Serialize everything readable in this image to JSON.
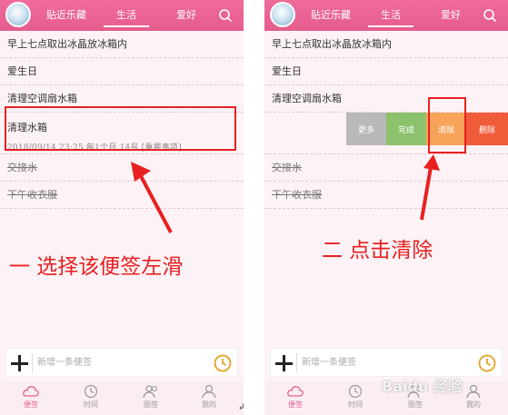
{
  "left_phone": {
    "tabs": [
      "贴近乐藏",
      "生活",
      "爱好"
    ],
    "rows": [
      {
        "text": "早上七点取出冰晶放冰箱内",
        "done": false
      },
      {
        "text": "爱生日",
        "done": false
      },
      {
        "text": "清理空调扇水箱",
        "done": false
      }
    ],
    "selected": {
      "title": "清理水箱",
      "meta": "2018/09/14 23:25  每1个月  14号    [重要事项]"
    },
    "done_rows": [
      "交接水",
      "下午收衣服"
    ],
    "input_placeholder": "新增一条便签",
    "tabbar": [
      "便签",
      "时间",
      "图签",
      "我的"
    ]
  },
  "right_phone": {
    "tabs": [
      "贴近乐藏",
      "生活",
      "爱好"
    ],
    "rows": [
      {
        "text": "早上七点取出冰晶放冰箱内",
        "done": false
      },
      {
        "text": "爱生日",
        "done": false
      },
      {
        "text": "清理空调扇水箱",
        "done": false
      }
    ],
    "swipe_actions": {
      "more": "更多",
      "done": "完成",
      "clear": "清除",
      "delete": "删除"
    },
    "done_rows": [
      "交接水",
      "下午收衣服"
    ],
    "input_placeholder": "新增一条便签",
    "tabbar": [
      "便签",
      "时间",
      "图签",
      "我的"
    ]
  },
  "captions": {
    "step1": "一  选择该便签左滑",
    "step2": "二  点击清除"
  },
  "watermark": "Baidu 经验",
  "colors": {
    "header": "#e45d8e",
    "accent_red": "#e82020",
    "clear_orange": "#f7a35a"
  }
}
